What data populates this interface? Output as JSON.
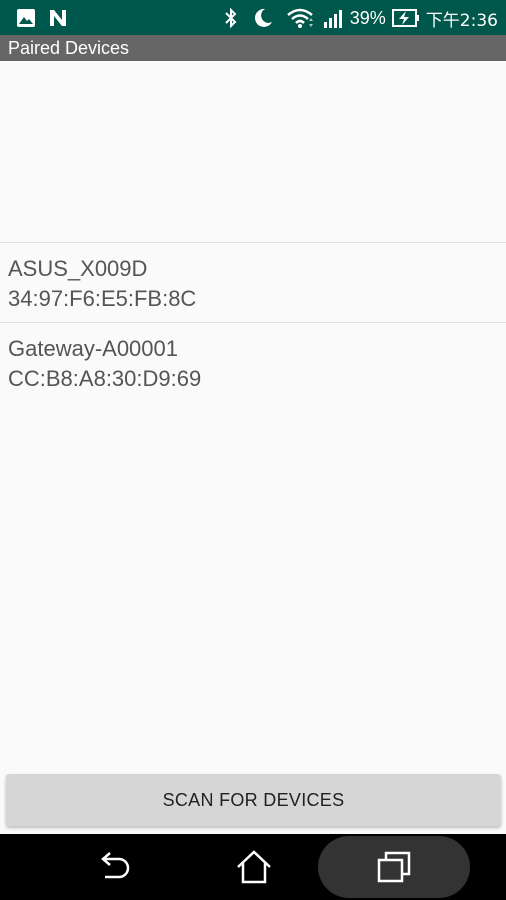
{
  "status_bar": {
    "battery_percent": "39%",
    "time": "下午2:36",
    "icons": [
      "image-icon",
      "n-notification-icon",
      "bluetooth-icon",
      "moon-icon",
      "wifi-icon",
      "signal-icon",
      "battery-charging-icon"
    ]
  },
  "header": {
    "title": "Paired Devices"
  },
  "devices": [
    {
      "name": "ASUS_X009D",
      "address": "34:97:F6:E5:FB:8C"
    },
    {
      "name": "Gateway-A00001",
      "address": "CC:B8:A8:30:D9:69"
    }
  ],
  "scan_button": {
    "label": "SCAN FOR DEVICES"
  },
  "nav_bar": {
    "buttons": [
      "back-icon",
      "home-icon",
      "recents-icon"
    ]
  },
  "colors": {
    "status_bar": "#00574b",
    "header": "#666666",
    "background": "#fafafa",
    "button": "#d6d6d6"
  }
}
